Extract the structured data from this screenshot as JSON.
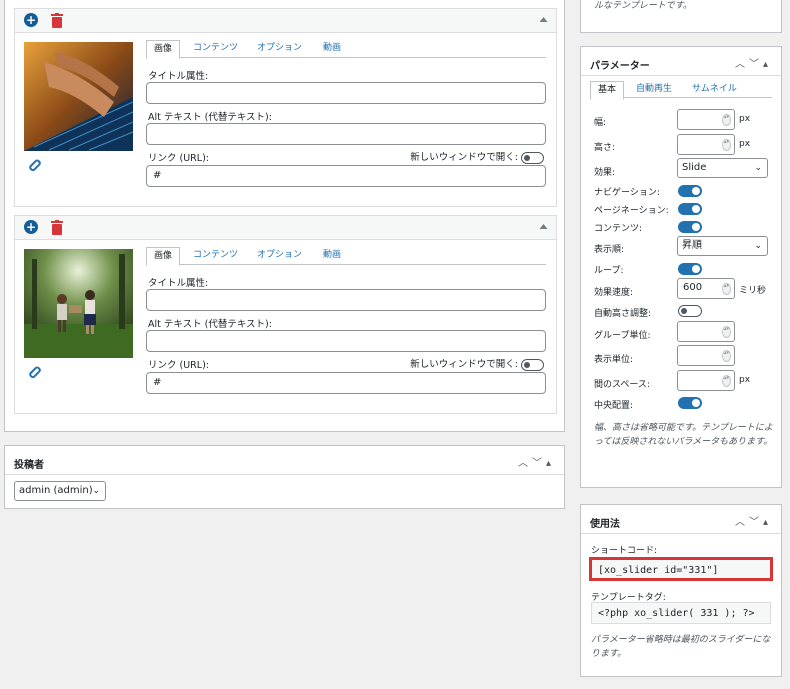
{
  "slides": [
    {
      "tabs": [
        "画像",
        "コンテンツ",
        "オプション",
        "動画"
      ],
      "title_label": "タイトル属性:",
      "title_value": "",
      "alt_label": "Alt テキスト (代替テキスト):",
      "alt_value": "",
      "link_label": "リンク (URL):",
      "link_value": "#",
      "new_window_label": "新しいウィンドウで開く:"
    },
    {
      "tabs": [
        "画像",
        "コンテンツ",
        "オプション",
        "動画"
      ],
      "title_label": "タイトル属性:",
      "title_value": "",
      "alt_label": "Alt テキスト (代替テキスト):",
      "alt_value": "",
      "link_label": "リンク (URL):",
      "link_value": "#",
      "new_window_label": "新しいウィンドウで開く:"
    }
  ],
  "author": {
    "title": "投稿者",
    "selected": "admin (admin)"
  },
  "top_note": "ルなテンプレートです。",
  "params": {
    "title": "パラメーター",
    "tabs": [
      "基本",
      "自動再生",
      "サムネイル"
    ],
    "width_label": "幅:",
    "height_label": "高さ:",
    "unit_px": "px",
    "effect_label": "効果:",
    "effect_value": "Slide",
    "navigation_label": "ナビゲーション:",
    "pagination_label": "ページネーション:",
    "content_label": "コンテンツ:",
    "order_label": "表示順:",
    "order_value": "昇順",
    "loop_label": "ループ:",
    "speed_label": "効果速度:",
    "speed_value": "600",
    "speed_unit": "ミリ秒",
    "autoheight_label": "自動高さ調整:",
    "group_label": "グループ単位:",
    "display_label": "表示単位:",
    "space_label": "間のスペース:",
    "center_label": "中央配置:",
    "note": "幅、高さは省略可能です。テンプレートによっては反映されないパラメータもあります。"
  },
  "usage": {
    "title": "使用法",
    "shortcode_label": "ショートコード:",
    "shortcode": "[xo_slider id=\"331\"]",
    "template_label": "テンプレートタグ:",
    "template_code": "<?php xo_slider( 331 ); ?>",
    "note": "パラメーター省略時は最初のスライダーになります。"
  },
  "colors": {
    "accent": "#2271b1",
    "highlight": "#d63638",
    "trash": "#d63638"
  }
}
